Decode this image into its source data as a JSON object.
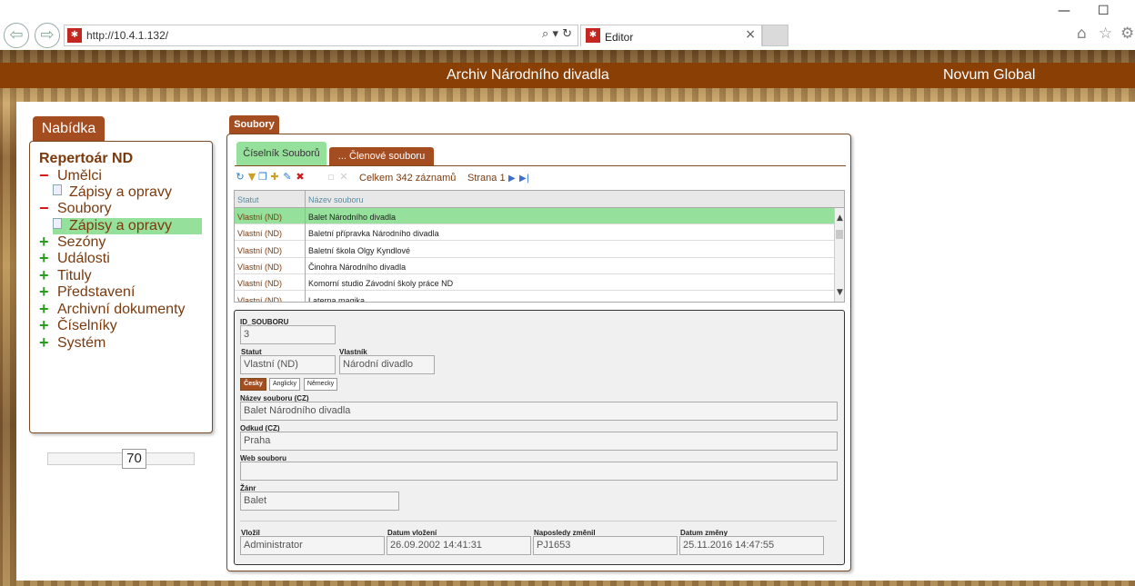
{
  "browser": {
    "url": "http://10.4.1.132/",
    "tab_title": "Editor",
    "minimize": "—",
    "maximize": "☐",
    "search_tools": "⌕ ▾ ↻"
  },
  "header": {
    "title": "Archiv Národního divadla",
    "company": "Novum Global"
  },
  "menu": {
    "tab_label": "Nabídka",
    "title": "Repertoár ND",
    "items": [
      {
        "label": "Umělci",
        "state": "expanded"
      },
      {
        "label": "Zápisy a opravy",
        "sub": true
      },
      {
        "label": "Soubory",
        "state": "expanded"
      },
      {
        "label": "Zápisy a opravy",
        "sub": true,
        "selected": true
      },
      {
        "label": "Sezóny",
        "state": "collapsed"
      },
      {
        "label": "Události",
        "state": "collapsed"
      },
      {
        "label": "Tituly",
        "state": "collapsed"
      },
      {
        "label": "Představení",
        "state": "collapsed"
      },
      {
        "label": "Archivní dokumenty",
        "state": "collapsed"
      },
      {
        "label": "Číselníky",
        "state": "collapsed"
      },
      {
        "label": "Systém",
        "state": "collapsed"
      }
    ],
    "slider_value": "70"
  },
  "main": {
    "tab_label": "Soubory",
    "subtabs": [
      "Číselník Souborů",
      "... Členové souboru"
    ],
    "total": "Celkem 342 záznamů",
    "page": "Strana 1",
    "grid": {
      "columns": [
        "Statut",
        "Název souboru"
      ],
      "rows": [
        [
          "Vlastní (ND)",
          "Balet Národního divadla"
        ],
        [
          "Vlastní (ND)",
          "Baletní přípravka Národního divadla"
        ],
        [
          "Vlastní (ND)",
          "Baletní škola Olgy Kyndlové"
        ],
        [
          "Vlastní (ND)",
          "Činohra Národního divadla"
        ],
        [
          "Vlastní (ND)",
          "Komorní studio Závodní školy práce ND"
        ],
        [
          "Vlastní (ND)",
          "Laterna magika"
        ]
      ]
    },
    "detail": {
      "id_label": "ID_SOUBORU",
      "id_value": "3",
      "statut_label": "Statut",
      "statut_value": "Vlastní (ND)",
      "vlastnik_label": "Vlastník",
      "vlastnik_value": "Národní divadlo",
      "languages": [
        "Česky",
        "Anglicky",
        "Německy"
      ],
      "nazev_label": "Název souboru (CZ)",
      "nazev_value": "Balet Národního divadla",
      "odkud_label": "Odkud (CZ)",
      "odkud_value": "Praha",
      "web_label": "Web souboru",
      "web_value": "",
      "zanr_label": "Žánr",
      "zanr_value": "Balet",
      "vlozil_label": "Vložil",
      "vlozil_value": "Administrator",
      "datum_vlozeni_label": "Datum vložení",
      "datum_vlozeni_value": "26.09.2002 14:41:31",
      "zmenil_label": "Naposledy změnil",
      "zmenil_value": "PJ1653",
      "datum_zmeny_label": "Datum změny",
      "datum_zmeny_value": "25.11.2016 14:47:55"
    }
  }
}
